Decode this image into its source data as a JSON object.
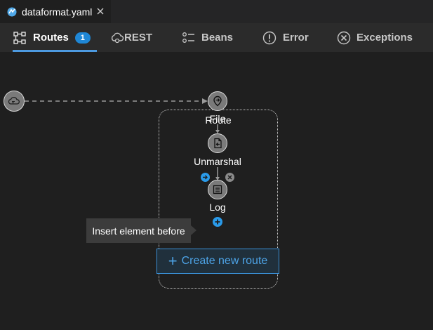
{
  "file_tab": {
    "name": "dataformat.yaml",
    "close_icon": "close-icon"
  },
  "nav": {
    "tabs": [
      {
        "label": "Routes",
        "icon": "routes-icon",
        "badge": "1",
        "active": true
      },
      {
        "label": "REST",
        "icon": "cloud-gear-icon"
      },
      {
        "label": "Beans",
        "icon": "beans-icon"
      },
      {
        "label": "Error",
        "icon": "error-icon"
      },
      {
        "label": "Exceptions",
        "icon": "exceptions-icon"
      }
    ]
  },
  "route": {
    "title": "Route",
    "nodes": [
      {
        "label": "File",
        "icon": "file-icon"
      },
      {
        "label": "Unmarshal",
        "icon": "unmarshal-icon"
      },
      {
        "label": "Log",
        "icon": "log-icon"
      }
    ]
  },
  "tooltip": {
    "text": "Insert element before"
  },
  "create_button": {
    "label": "Create new route",
    "plus": "+"
  },
  "colors": {
    "accent": "#1f87d6",
    "background": "#1f1f1f",
    "tab_underline": "#4d9ae0"
  }
}
